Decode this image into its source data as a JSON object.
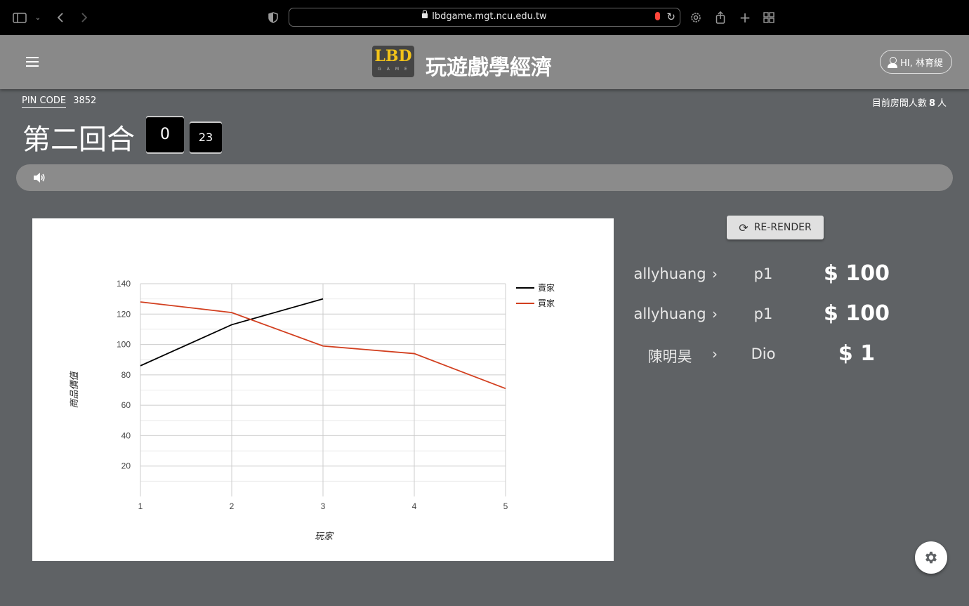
{
  "browser": {
    "url": "lbdgame.mgt.ncu.edu.tw"
  },
  "header": {
    "logo_text": "LBD",
    "logo_sub": "GAME",
    "title": "玩遊戲學經濟",
    "user_label": "HI, 林育緹"
  },
  "room": {
    "pin_label": "PIN CODE",
    "pin_value": "3852",
    "count_prefix": "目前房間人數",
    "count_value": "8",
    "count_suffix": "人"
  },
  "round": {
    "title": "第二回合",
    "minutes": "0",
    "seconds": "23"
  },
  "rerender_label": "RE-RENDER",
  "trades": [
    {
      "seller": "allyhuang",
      "buyer": "p1",
      "price": "$ 100"
    },
    {
      "seller": "allyhuang",
      "buyer": "p1",
      "price": "$ 100"
    },
    {
      "seller": "陳明昊",
      "buyer": "Dio",
      "price": "$ 1"
    }
  ],
  "colors": {
    "seller_line": "#000000",
    "buyer_line": "#d23f1f"
  },
  "chart_data": {
    "type": "line",
    "x": [
      1,
      2,
      3,
      4,
      5
    ],
    "xlabel": "玩家",
    "ylabel": "商品價值",
    "ylim": [
      0,
      140
    ],
    "yticks": [
      20,
      40,
      60,
      80,
      100,
      120,
      140
    ],
    "legend_position": "right",
    "grid": true,
    "series": [
      {
        "name": "賣家",
        "x": [
          1,
          2,
          3
        ],
        "values": [
          86,
          113,
          130
        ]
      },
      {
        "name": "買家",
        "x": [
          1,
          2,
          3,
          4,
          5
        ],
        "values": [
          128,
          121,
          99,
          94,
          71
        ]
      }
    ]
  }
}
